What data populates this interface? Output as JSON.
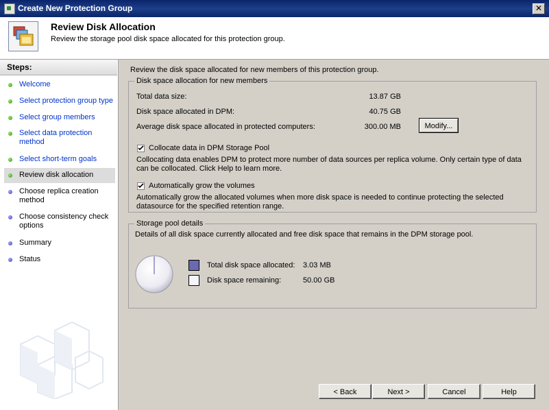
{
  "window": {
    "title": "Create New Protection Group",
    "close_glyph": "✕"
  },
  "header": {
    "title": "Review Disk Allocation",
    "subtitle": "Review the storage pool disk space allocated for this protection group."
  },
  "sidebar": {
    "heading": "Steps:",
    "steps": [
      {
        "label": "Welcome",
        "state": "done"
      },
      {
        "label": "Select protection group type",
        "state": "done"
      },
      {
        "label": "Select group members",
        "state": "done"
      },
      {
        "label": "Select data protection method",
        "state": "done"
      },
      {
        "label": "Select short-term goals",
        "state": "done"
      },
      {
        "label": "Review disk allocation",
        "state": "current"
      },
      {
        "label": "Choose replica creation method",
        "state": "todo"
      },
      {
        "label": "Choose consistency check options",
        "state": "todo"
      },
      {
        "label": "Summary",
        "state": "todo"
      },
      {
        "label": "Status",
        "state": "todo"
      }
    ]
  },
  "main": {
    "intro": "Review the disk space allocated for new members of this protection group.",
    "allocation": {
      "legend": "Disk space allocation for new members",
      "rows": [
        {
          "label": "Total data size:",
          "value": "13.87 GB"
        },
        {
          "label": "Disk space allocated in DPM:",
          "value": "40.75 GB"
        },
        {
          "label": "Average disk space allocated in protected computers:",
          "value": "300.00 MB"
        }
      ],
      "modify_label": "Modify...",
      "collocate": {
        "checked": true,
        "label": "Collocate data in DPM Storage Pool",
        "desc": "Collocating data enables DPM to protect more number of data sources per replica volume. Only certain type of data can be collocated. Click Help to learn more."
      },
      "autogrow": {
        "checked": true,
        "label": "Automatically grow the volumes",
        "desc": "Automatically grow the allocated volumes when more disk space is needed to continue protecting the selected datasource for the specified retention range."
      }
    },
    "storage": {
      "legend": "Storage pool details",
      "desc": "Details of all disk space currently allocated and free disk space that remains in the DPM storage pool.",
      "allocated_fraction": 6e-05,
      "items": [
        {
          "label": "Total disk space allocated:",
          "value": "3.03 MB",
          "color": "#6a6ab0"
        },
        {
          "label": "Disk space remaining:",
          "value": "50.00 GB",
          "color": "#f4f4fa"
        }
      ]
    }
  },
  "footer": {
    "back": "< Back",
    "next": "Next >",
    "cancel": "Cancel",
    "help": "Help"
  }
}
